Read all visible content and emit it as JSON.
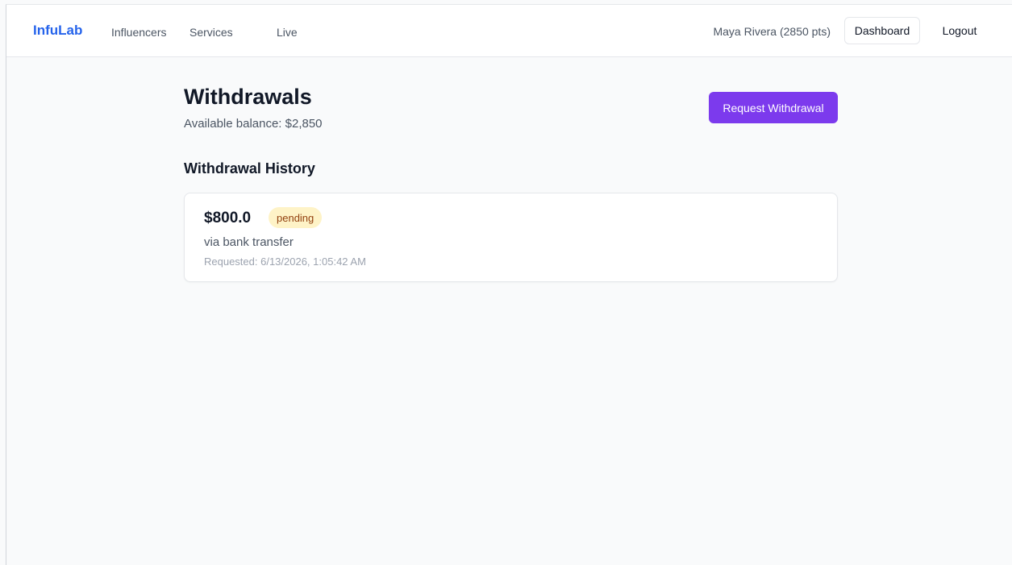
{
  "nav": {
    "brand": "InfuLab",
    "links": [
      "Influencers",
      "Services",
      "Live"
    ],
    "user": "Maya Rivera (2850 pts)",
    "dashboard_label": "Dashboard",
    "logout_label": "Logout"
  },
  "page": {
    "title": "Withdrawals",
    "balance": "Available balance: $2,850",
    "request_button": "Request Withdrawal",
    "history_title": "Withdrawal History"
  },
  "withdrawals": [
    {
      "amount": "$800.0",
      "status": "pending",
      "method": "via bank transfer",
      "requested": "Requested: 6/13/2026, 1:05:42 AM"
    }
  ],
  "colors": {
    "brand": "#2563eb",
    "primary_button": "#7c3aed",
    "pending_badge_bg": "#fef3c7",
    "pending_badge_text": "#92400e"
  }
}
